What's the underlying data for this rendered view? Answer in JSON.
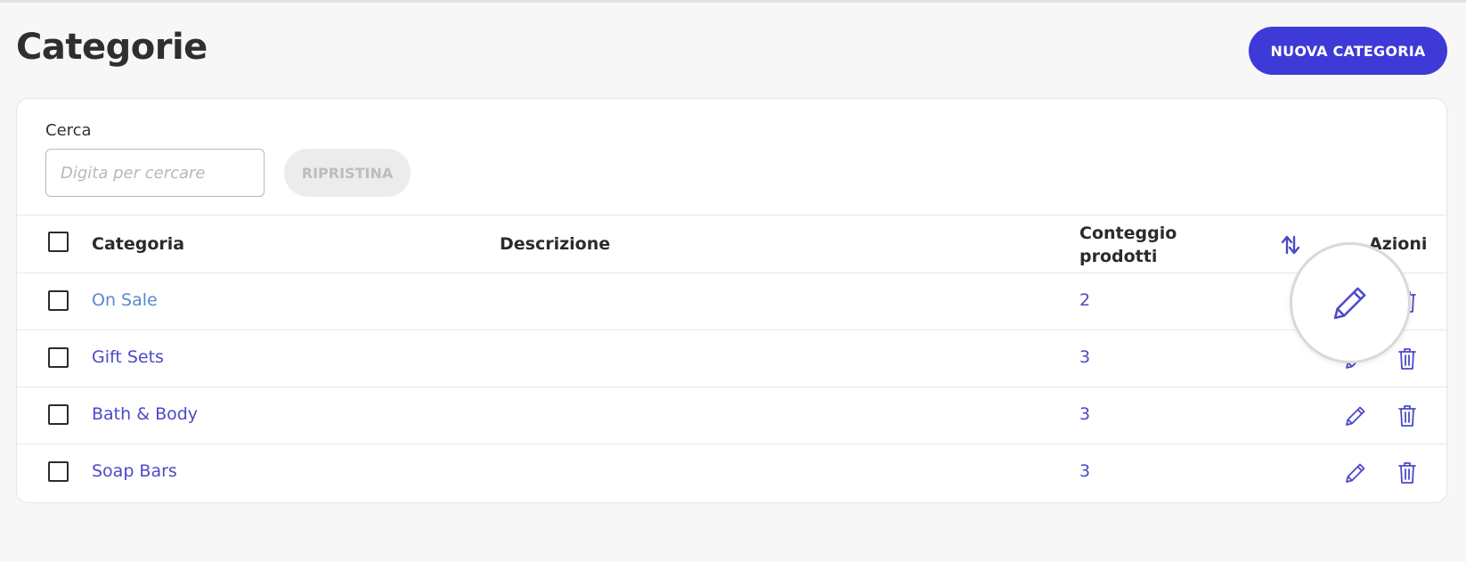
{
  "page": {
    "title": "Categorie"
  },
  "toolbar": {
    "new_category_label": "NUOVA CATEGORIA"
  },
  "search": {
    "label": "Cerca",
    "placeholder": "Digita per cercare",
    "value": "",
    "reset_label": "RIPRISTINA"
  },
  "table": {
    "headers": {
      "category": "Categoria",
      "description": "Descrizione",
      "count_line1": "Conteggio",
      "count_line2": "prodotti",
      "actions": "Azioni"
    },
    "rows": [
      {
        "name": "On Sale",
        "description": "",
        "count": "2"
      },
      {
        "name": "Gift Sets",
        "description": "",
        "count": "3"
      },
      {
        "name": "Bath & Body",
        "description": "",
        "count": "3"
      },
      {
        "name": "Soap Bars",
        "description": "",
        "count": "3"
      }
    ]
  },
  "icons": {
    "sort": "sort-arrows-icon",
    "edit": "pencil-icon",
    "delete": "trash-icon"
  },
  "colors": {
    "accent": "#3d3ad8",
    "link": "#4c49c8",
    "link_first": "#5b86d6",
    "reset_bg": "#ececec"
  }
}
